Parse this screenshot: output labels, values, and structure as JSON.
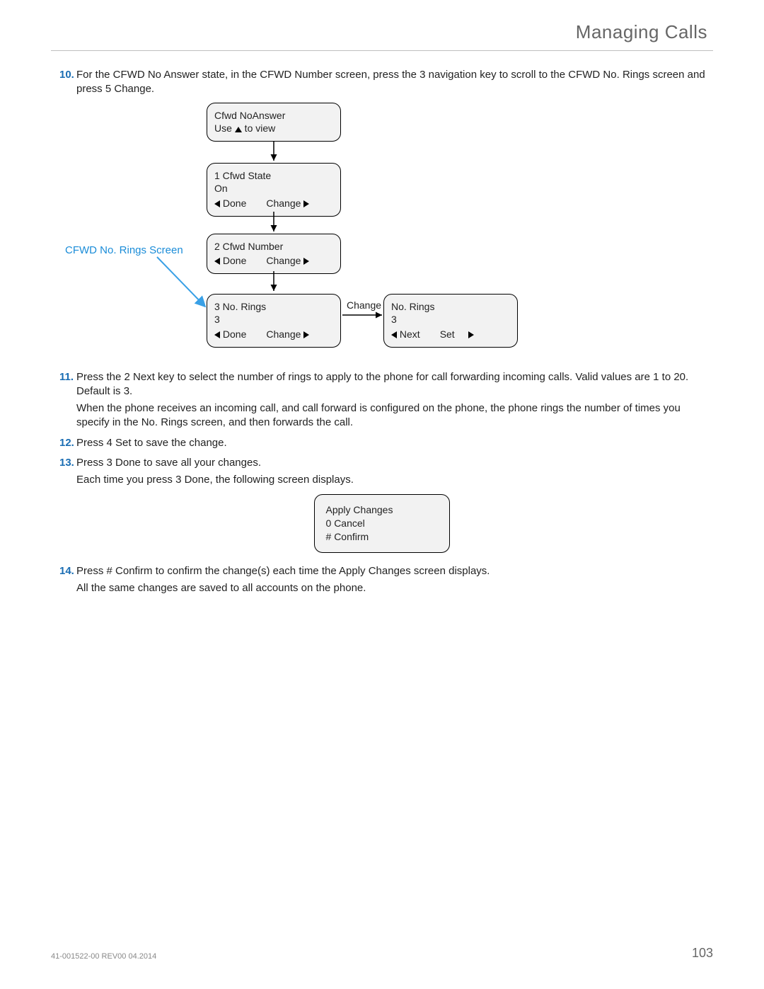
{
  "header": {
    "title": "Managing Calls"
  },
  "steps": {
    "s10": {
      "num": "10.",
      "text_a": "For the CFWD No Answer state, in the CFWD Number screen, press the ",
      "text_b": "3",
      "text_c": " navigation key to scroll to the CFWD No. Rings screen and press ",
      "text_d": "5 Change",
      "text_e": "."
    },
    "s11": {
      "num": "11.",
      "text_a": "Press the ",
      "text_b": "2 Next",
      "text_c": " key to select the number of rings to apply to the phone for call forwarding incoming calls. Valid values are 1 to 20. Default is 3.",
      "text_d": "When the phone receives an incoming call, and call forward is configured on the phone, the phone rings the number of times you specify in the No. Rings screen, and then forwards the call."
    },
    "s12": {
      "num": "12.",
      "text_a": "Press ",
      "text_b": "4  Set",
      "text_c": " to save the change."
    },
    "s13": {
      "num": "13.",
      "text_a": "Press ",
      "text_b": "3  Done",
      "text_c": " to save all your changes.",
      "text_d": "Each time you press ",
      "text_e": "3  Done",
      "text_f": ", the following screen displays."
    },
    "s14": {
      "num": "14.",
      "text_a": "Press ",
      "text_b": "# Confirm",
      "text_c": " to confirm the change(s) each time the Apply Changes screen displays.",
      "text_d": "All the same changes are saved to all accounts on the phone."
    }
  },
  "diagram": {
    "callout": "CFWD No. Rings Screen",
    "change_label": "Change",
    "box1": {
      "l1": "Cfwd NoAnswer",
      "l2a": "Use ",
      "l2b": " to view"
    },
    "box2": {
      "l1": "1  Cfwd State",
      "l2": "On",
      "done": "Done",
      "change": "Change"
    },
    "box3": {
      "l1": "2  Cfwd Number",
      "done": "Done",
      "change": "Change"
    },
    "box4": {
      "l1": "3  No. Rings",
      "l2": "3",
      "done": "Done",
      "change": "Change"
    },
    "box5": {
      "l1": "No. Rings",
      "l2": "3",
      "next": "Next",
      "set": "Set"
    }
  },
  "apply": {
    "l1": "Apply Changes",
    "l2": "0 Cancel",
    "l3": "# Confirm"
  },
  "footer": {
    "doc": "41-001522-00 REV00    04.2014",
    "page": "103"
  }
}
